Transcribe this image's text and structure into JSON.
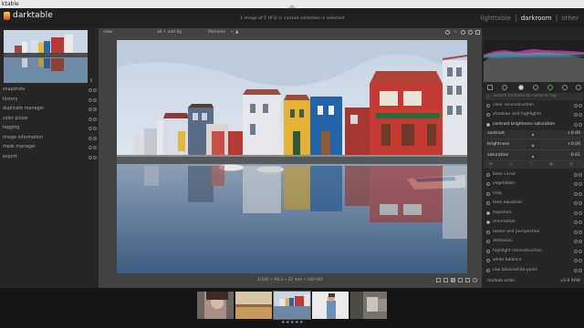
{
  "titlebar": {
    "text": "ktable"
  },
  "header": {
    "app_name": "darktable",
    "image_count": "1 image of 5 (#3) in current collection is selected",
    "views": [
      "lighttable",
      "darkroom",
      "other"
    ],
    "active_view": "darkroom",
    "separator": "|"
  },
  "left_panel": {
    "modules": [
      "snapshots",
      "history",
      "duplicate manager",
      "color picker",
      "tagging",
      "image information",
      "mask manager",
      "export"
    ]
  },
  "center_toolbar": {
    "left": "view",
    "all": "all",
    "sort_by": "sort by",
    "filename": "filename",
    "arrow": "▲"
  },
  "center": {
    "exif": "1/100 • f/6.3 • 22 mm • 100 ISO"
  },
  "right_panel": {
    "search_placeholder": "search modules by name or tag",
    "top_modules": [
      "color reconstruction",
      "shadows and highlights",
      "contrast brightness saturation"
    ],
    "sliders": [
      {
        "label": "contrast",
        "value": "+0.00",
        "level": 0.5
      },
      {
        "label": "brightness",
        "value": "+0.00",
        "level": 0.5
      },
      {
        "label": "saturation",
        "value": "-0.01",
        "level": 0.5
      }
    ],
    "bottom_modules": [
      "base curve",
      "vegetation",
      "crop",
      "tone equalizer",
      "exposure",
      "orientation",
      "rotate and perspective",
      "demosaic",
      "highlight reconstruction",
      "white balance",
      "raw black/white point"
    ],
    "module_order_label": "module order",
    "module_order_value": "v3.0 RAW"
  },
  "filmstrip": {
    "rating_stars": "★★★★★"
  },
  "colors": {
    "accent_logo": "#e43d34",
    "panel_bg": "#262626",
    "center_bg": "#424242"
  }
}
